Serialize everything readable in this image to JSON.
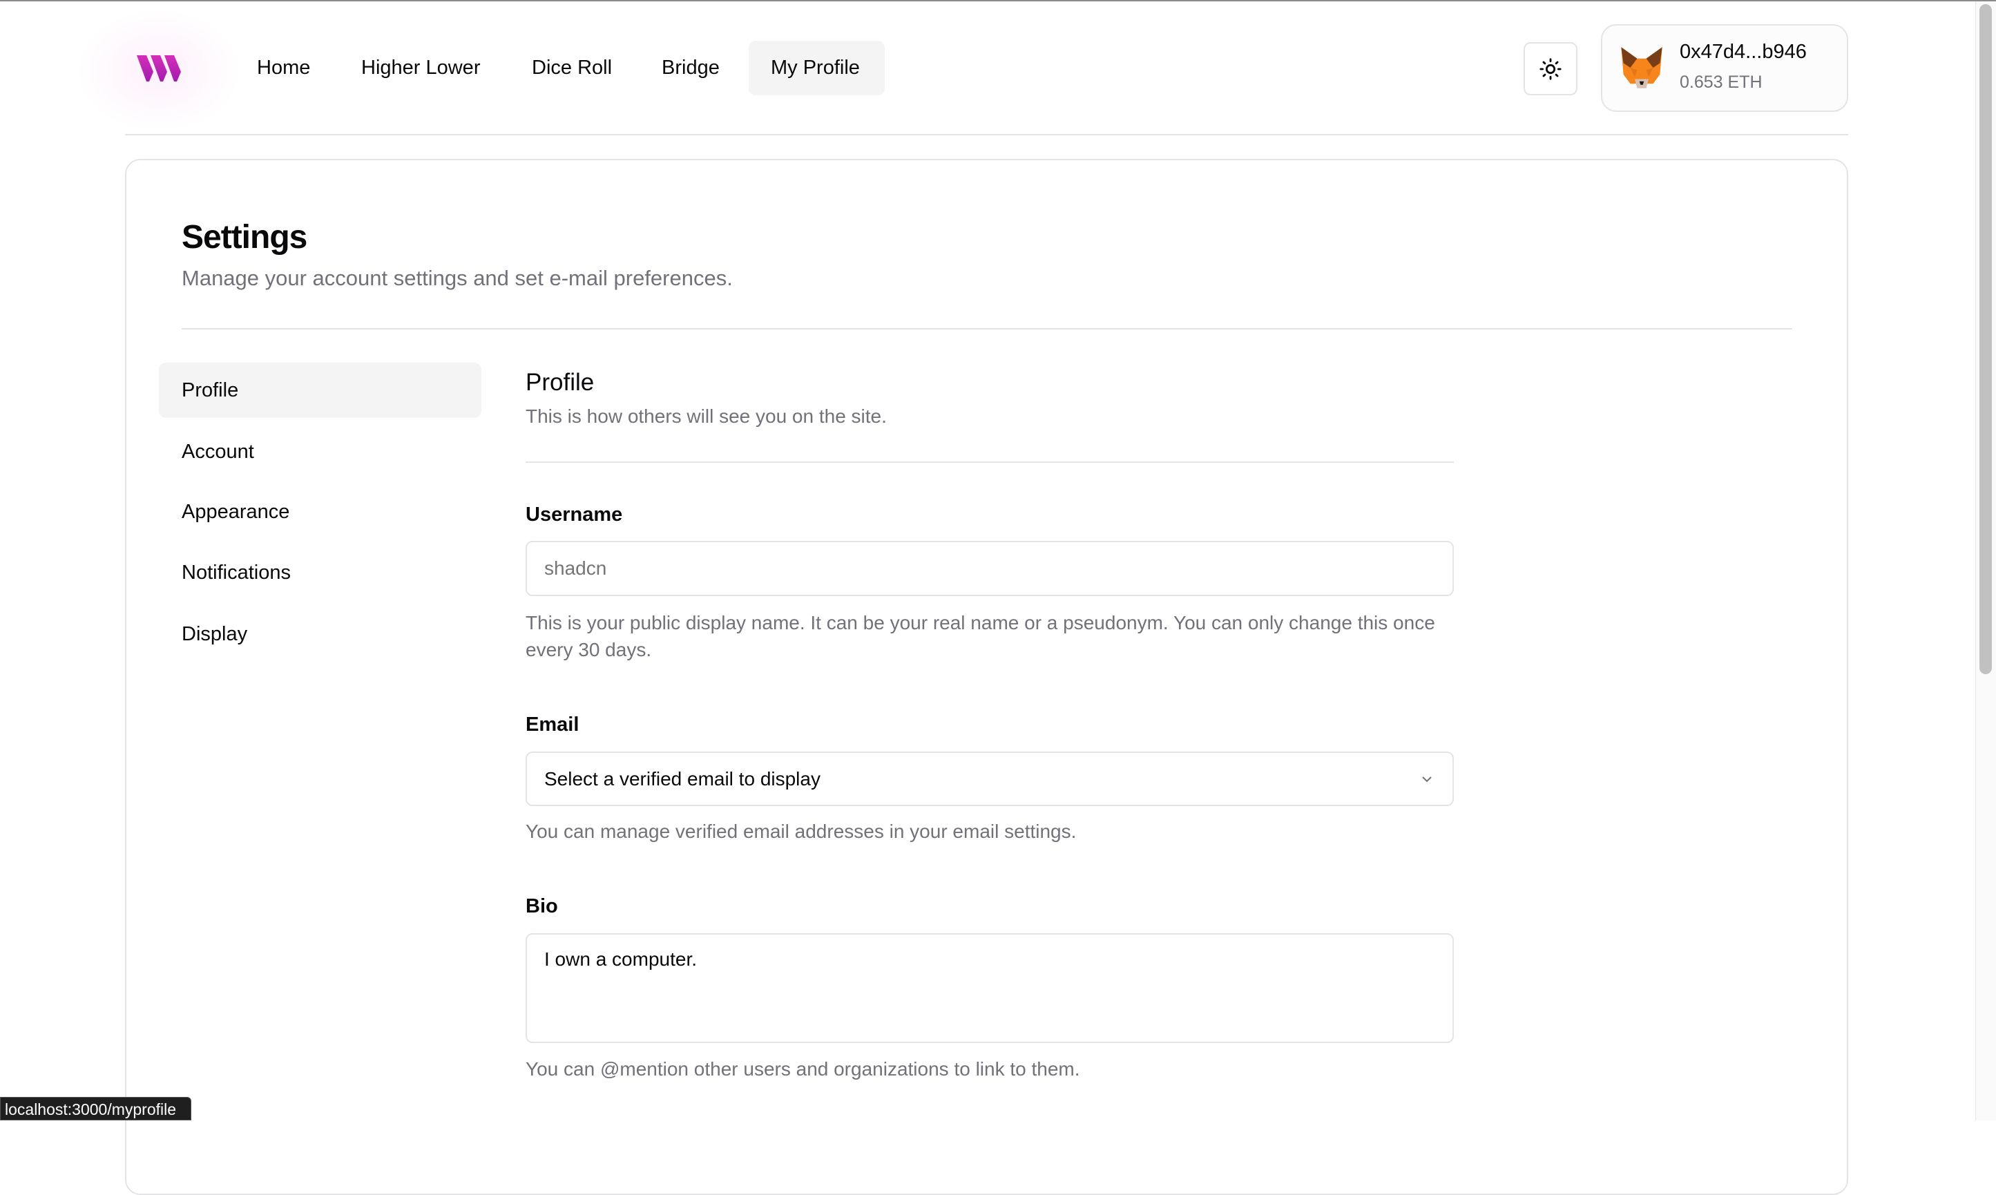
{
  "nav": {
    "items": [
      {
        "label": "Home"
      },
      {
        "label": "Higher Lower"
      },
      {
        "label": "Dice Roll"
      },
      {
        "label": "Bridge"
      },
      {
        "label": "My Profile",
        "active": true
      }
    ]
  },
  "header": {
    "theme_icon": "sun-icon",
    "wallet": {
      "address": "0x47d4...b946",
      "balance": "0.653 ETH",
      "icon": "metamask-fox-icon"
    }
  },
  "settings": {
    "title": "Settings",
    "subtitle": "Manage your account settings and set e-mail preferences."
  },
  "sidebar": {
    "items": [
      {
        "label": "Profile"
      },
      {
        "label": "Account"
      },
      {
        "label": "Appearance"
      },
      {
        "label": "Notifications"
      },
      {
        "label": "Display"
      }
    ]
  },
  "profile": {
    "title": "Profile",
    "description": "This is how others will see you on the site.",
    "username": {
      "label": "Username",
      "placeholder": "shadcn",
      "help": "This is your public display name. It can be your real name or a pseudonym. You can only change this once every 30 days."
    },
    "email": {
      "label": "Email",
      "value": "Select a verified email to display",
      "help": "You can manage verified email addresses in your email settings."
    },
    "bio": {
      "label": "Bio",
      "value": "I own a computer.",
      "help": "You can @mention other users and organizations to link to them."
    }
  },
  "status_bar": {
    "url": "localhost:3000/myprofile"
  },
  "colors": {
    "brand": "#c026b3",
    "muted": "#71717a",
    "border": "#e4e4e7"
  }
}
